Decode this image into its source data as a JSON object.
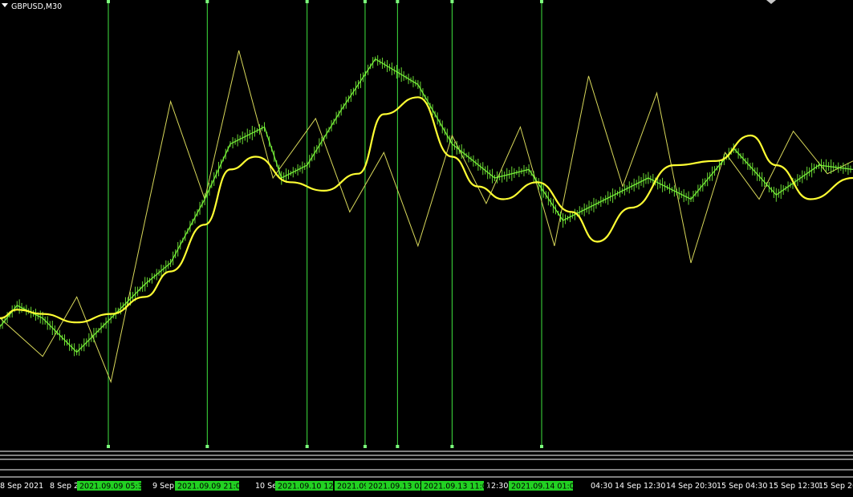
{
  "window": {
    "symbol_title": "GBPUSD,M30"
  },
  "chart_data": {
    "type": "line",
    "title": "GBPUSD,M30",
    "xlabel": "",
    "ylabel": "",
    "ylim": [
      0,
      100
    ],
    "grid": false,
    "price_axis_labels_visible": false,
    "x_ticks": [
      "8 Sep 2021",
      "8 Sep 2",
      "9 Sep",
      "10 Sep",
      "12:30",
      "04:30",
      "14 Sep 12:30",
      "14 Sep 20:30",
      "15 Sep 04:30",
      "15 Sep 12:30",
      "15 Sep 20"
    ],
    "vline_labels": [
      "2021.09.09 05:30",
      "2021.09.09 21:00",
      "2021.09.10 12:3",
      "2021.09.",
      "2021.09.13 02:",
      "2021.09.13 11:00",
      "2021.09.14 01:00"
    ],
    "series": [
      {
        "name": "",
        "style": "price",
        "color": "#7dff3c",
        "x": [
          0,
          2,
          5,
          9,
          13,
          17,
          20,
          24,
          27,
          31,
          33,
          36,
          40,
          44,
          49,
          53,
          58,
          62,
          66,
          71,
          76,
          81,
          86,
          91,
          96,
          100
        ],
        "values": [
          25,
          30,
          27,
          19,
          27,
          35,
          40,
          55,
          68,
          72,
          60,
          63,
          76,
          88,
          82,
          68,
          60,
          62,
          50,
          55,
          60,
          55,
          67,
          56,
          63,
          62
        ]
      },
      {
        "name": "",
        "style": "smoothed",
        "color": "#ffff33",
        "x": [
          0,
          2,
          5,
          9,
          13,
          17,
          20,
          24,
          27,
          30,
          34,
          38,
          42,
          45,
          49,
          53,
          56,
          59,
          63,
          67,
          70,
          74,
          79,
          84,
          88,
          91,
          95,
          100
        ],
        "values": [
          27,
          29,
          28,
          26,
          28,
          32,
          38,
          49,
          62,
          65,
          59,
          57,
          61,
          75,
          79,
          65,
          58,
          55,
          59,
          52,
          45,
          53,
          63,
          64,
          70,
          63,
          55,
          60
        ]
      },
      {
        "name": "",
        "style": "zigzag",
        "color": "#d8d85a",
        "x": [
          0,
          5,
          9,
          13,
          17,
          20,
          24,
          28,
          32,
          37,
          41,
          45,
          49,
          53,
          57,
          61,
          65,
          69,
          73,
          77,
          81,
          85,
          89,
          93,
          97,
          100
        ],
        "values": [
          27,
          18,
          32,
          12,
          50,
          78,
          55,
          90,
          60,
          74,
          52,
          66,
          44,
          70,
          54,
          72,
          44,
          84,
          58,
          80,
          40,
          66,
          55,
          71,
          61,
          64
        ]
      }
    ],
    "vlines_x": [
      12.7,
      24.3,
      36.0,
      42.8,
      46.6,
      53.0,
      63.5
    ]
  }
}
